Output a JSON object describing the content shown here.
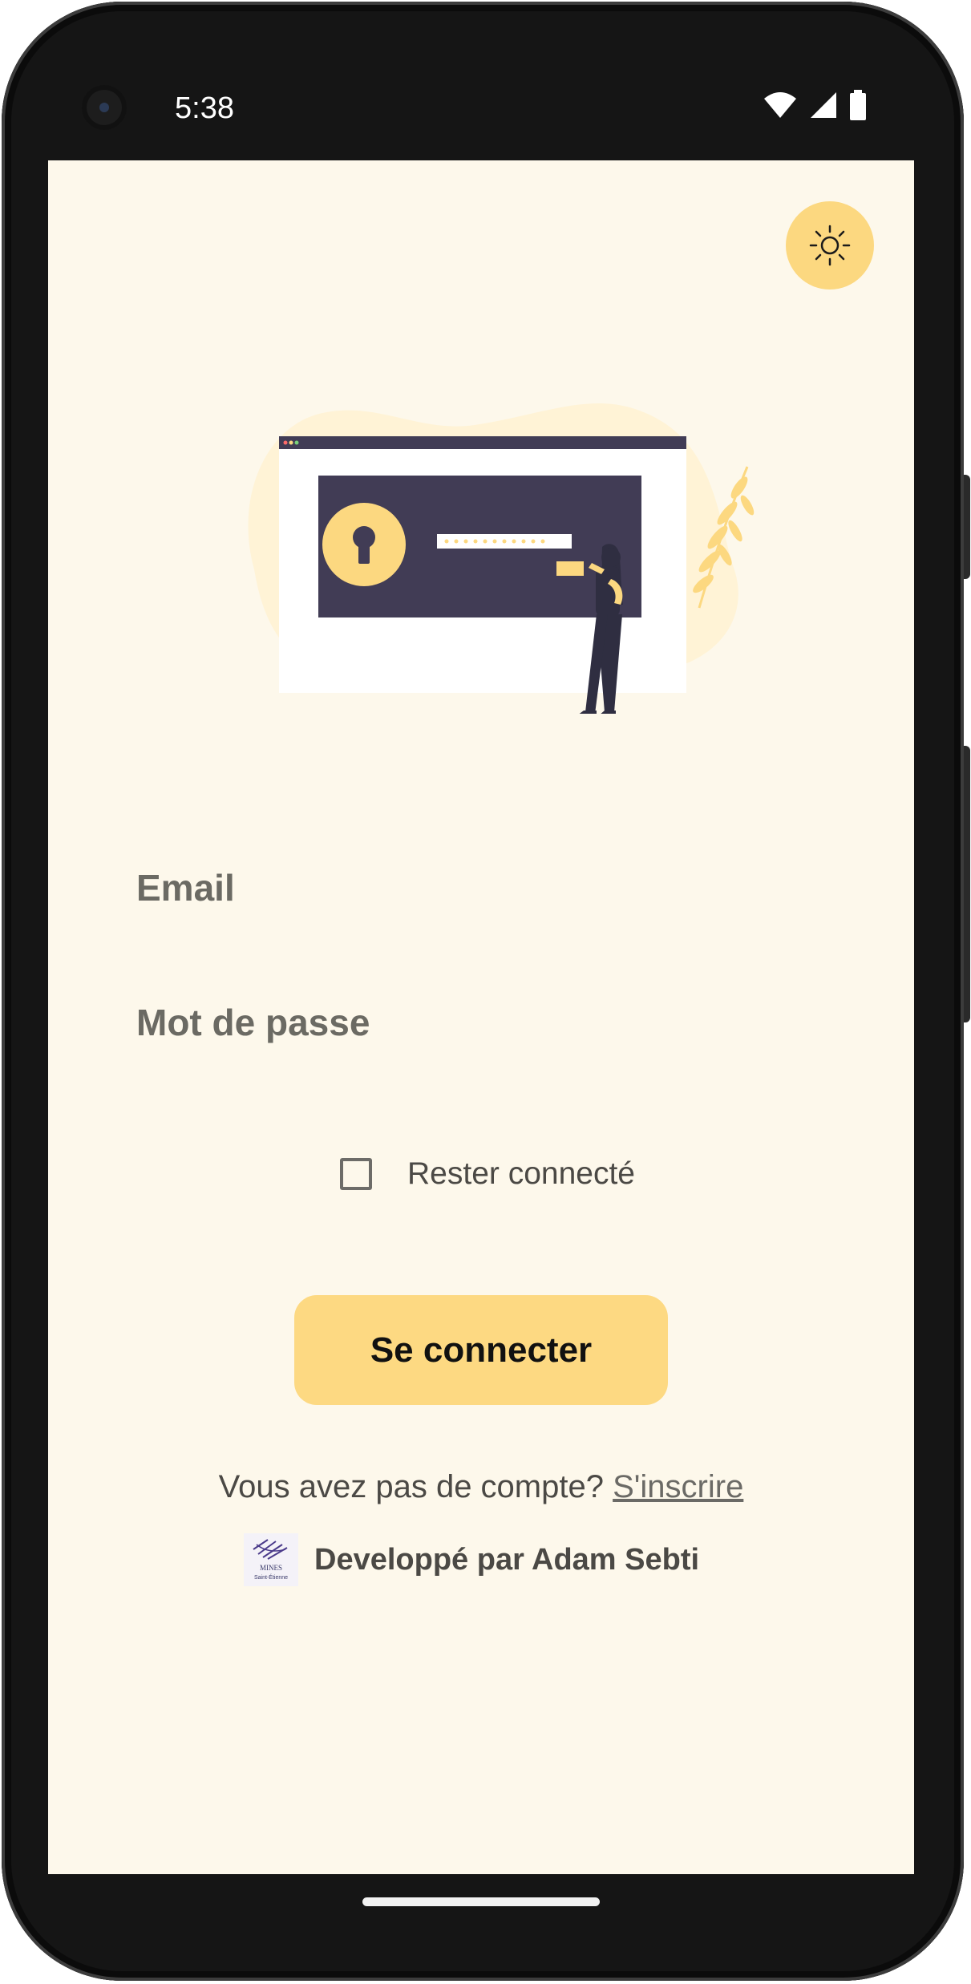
{
  "status_bar": {
    "time": "5:38"
  },
  "theme_toggle": {
    "icon": "sun-icon"
  },
  "illustration": {
    "description_icon": "login-lock-illustration"
  },
  "form": {
    "email_label": "Email",
    "password_label": "Mot de passe",
    "remember_label": "Rester connecté",
    "remember_checked": false,
    "submit_label": "Se connecter"
  },
  "signup": {
    "prompt": "Vous avez pas de compte?",
    "link": "S'inscrire"
  },
  "footer": {
    "credit": "Developpé par Adam Sebti",
    "logo_text": [
      "MINES",
      "Saint-Étienne"
    ]
  },
  "colors": {
    "background": "#fdf8eb",
    "accent": "#fdd982",
    "text": "#4b4945",
    "illustration_dark": "#413c55"
  }
}
